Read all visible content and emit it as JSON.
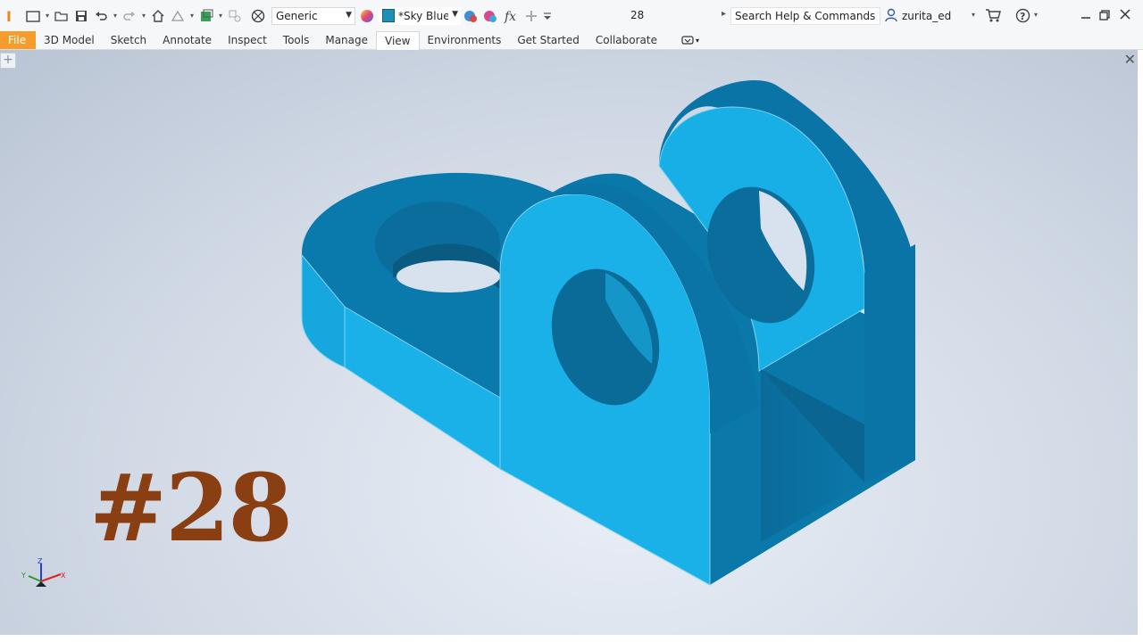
{
  "toolbar": {
    "material": "Generic",
    "appearance": "*Sky Blue N",
    "document_name": "28",
    "search_placeholder": "Search Help & Commands...",
    "user": "zurita_ed"
  },
  "tabs": [
    {
      "label": "File"
    },
    {
      "label": "3D Model"
    },
    {
      "label": "Sketch"
    },
    {
      "label": "Annotate"
    },
    {
      "label": "Inspect"
    },
    {
      "label": "Tools"
    },
    {
      "label": "Manage"
    },
    {
      "label": "View"
    },
    {
      "label": "Environments"
    },
    {
      "label": "Get Started"
    },
    {
      "label": "Collaborate"
    }
  ],
  "active_tab": "View",
  "viewport": {
    "overlay_label": "#28",
    "model_color": "#1ab0e8",
    "label_color": "#8a3f12"
  },
  "triad": {
    "x": "X",
    "y": "Y",
    "z": "Z"
  },
  "icons": [
    "app-logo-icon",
    "new-icon",
    "open-icon",
    "save-icon",
    "undo-icon",
    "redo-icon",
    "home-icon",
    "sketch-icon",
    "update-icon",
    "select-icon",
    "material-icon",
    "appearance-icon",
    "appearance-color-icon",
    "adjust-icon",
    "clear-icon",
    "fx-icon",
    "plus-icon",
    "customize-icon",
    "user-icon",
    "cart-icon",
    "help-icon",
    "minimize-icon",
    "restore-icon",
    "close-icon"
  ]
}
